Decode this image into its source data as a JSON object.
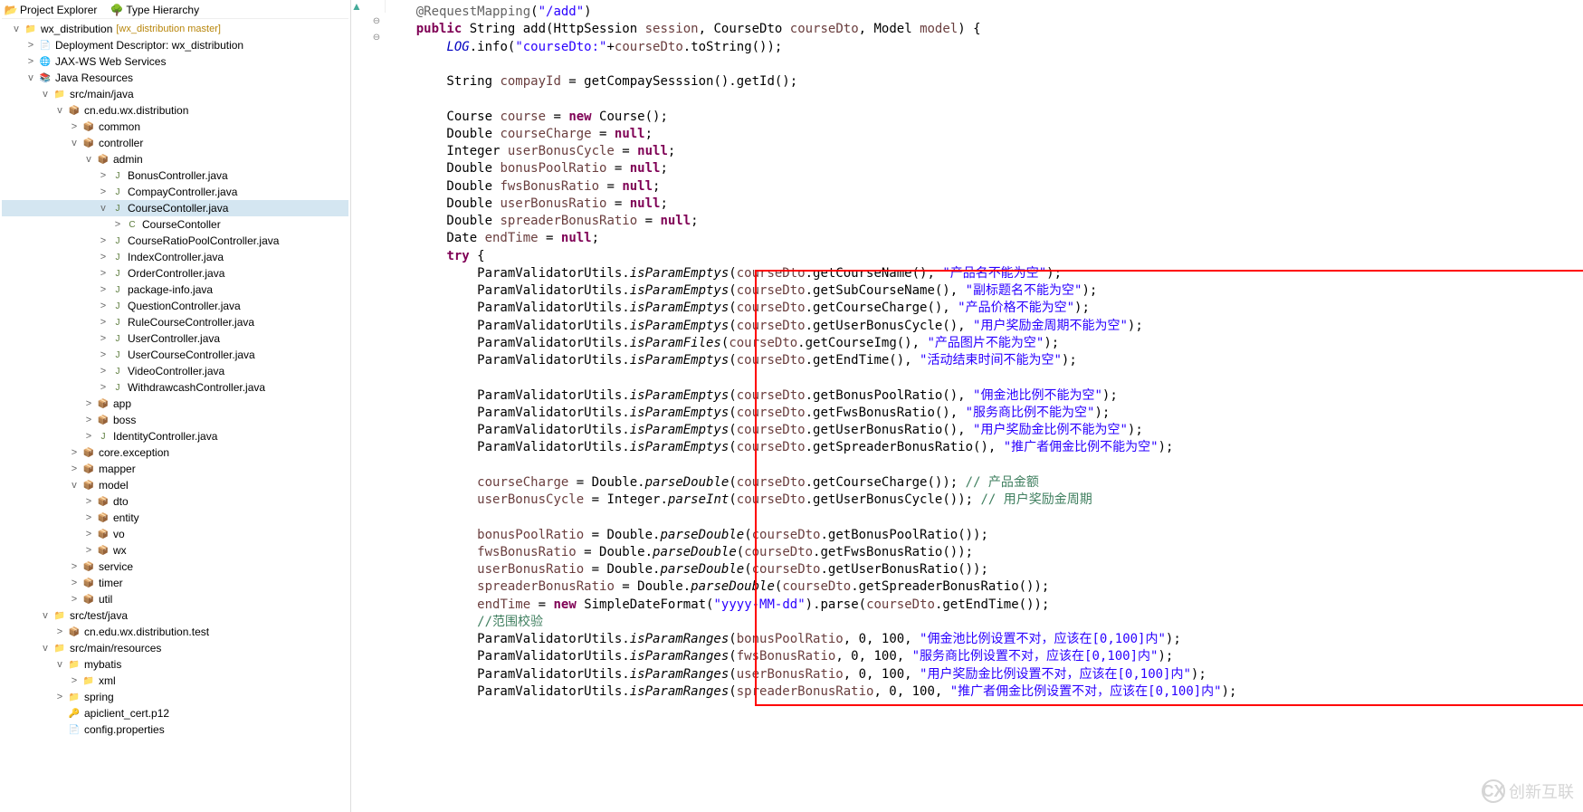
{
  "sidebar": {
    "tab1": "Project Explorer",
    "tab2": "Type Hierarchy",
    "root": {
      "label": "wx_distribution",
      "branch": "[wx_distribution master]"
    },
    "items": [
      {
        "label": "Deployment Descriptor: wx_distribution",
        "ind": 1,
        "exp": ">",
        "icon": "📄",
        "ic": "file-icon"
      },
      {
        "label": "JAX-WS Web Services",
        "ind": 1,
        "exp": ">",
        "icon": "🌐",
        "ic": "file-icon"
      },
      {
        "label": "Java Resources",
        "ind": 1,
        "exp": "v",
        "icon": "📚",
        "ic": "proj-icon"
      },
      {
        "label": "src/main/java",
        "ind": 2,
        "exp": "v",
        "icon": "📁",
        "ic": "folder-icon"
      },
      {
        "label": "cn.edu.wx.distribution",
        "ind": 3,
        "exp": "v",
        "icon": "📦",
        "ic": "pkg-icon"
      },
      {
        "label": "common",
        "ind": 4,
        "exp": ">",
        "icon": "📦",
        "ic": "pkg-icon"
      },
      {
        "label": "controller",
        "ind": 4,
        "exp": "v",
        "icon": "📦",
        "ic": "pkg-icon"
      },
      {
        "label": "admin",
        "ind": 5,
        "exp": "v",
        "icon": "📦",
        "ic": "pkg-icon"
      },
      {
        "label": "BonusController.java",
        "ind": 6,
        "exp": ">",
        "icon": "J",
        "ic": "java-icon"
      },
      {
        "label": "CompayController.java",
        "ind": 6,
        "exp": ">",
        "icon": "J",
        "ic": "java-icon"
      },
      {
        "label": "CourseContoller.java",
        "ind": 6,
        "exp": "v",
        "icon": "J",
        "ic": "java-icon",
        "sel": true
      },
      {
        "label": "CourseContoller",
        "ind": 7,
        "exp": ">",
        "icon": "C",
        "ic": "class-icon"
      },
      {
        "label": "CourseRatioPoolController.java",
        "ind": 6,
        "exp": ">",
        "icon": "J",
        "ic": "java-icon"
      },
      {
        "label": "IndexController.java",
        "ind": 6,
        "exp": ">",
        "icon": "J",
        "ic": "java-icon"
      },
      {
        "label": "OrderController.java",
        "ind": 6,
        "exp": ">",
        "icon": "J",
        "ic": "java-icon"
      },
      {
        "label": "package-info.java",
        "ind": 6,
        "exp": ">",
        "icon": "J",
        "ic": "java-icon"
      },
      {
        "label": "QuestionController.java",
        "ind": 6,
        "exp": ">",
        "icon": "J",
        "ic": "java-icon"
      },
      {
        "label": "RuleCourseController.java",
        "ind": 6,
        "exp": ">",
        "icon": "J",
        "ic": "java-icon"
      },
      {
        "label": "UserController.java",
        "ind": 6,
        "exp": ">",
        "icon": "J",
        "ic": "java-icon"
      },
      {
        "label": "UserCourseController.java",
        "ind": 6,
        "exp": ">",
        "icon": "J",
        "ic": "java-icon"
      },
      {
        "label": "VideoController.java",
        "ind": 6,
        "exp": ">",
        "icon": "J",
        "ic": "java-icon"
      },
      {
        "label": "WithdrawcashController.java",
        "ind": 6,
        "exp": ">",
        "icon": "J",
        "ic": "java-icon"
      },
      {
        "label": "app",
        "ind": 5,
        "exp": ">",
        "icon": "📦",
        "ic": "pkg-icon"
      },
      {
        "label": "boss",
        "ind": 5,
        "exp": ">",
        "icon": "📦",
        "ic": "pkg-icon"
      },
      {
        "label": "IdentityController.java",
        "ind": 5,
        "exp": ">",
        "icon": "J",
        "ic": "java-icon"
      },
      {
        "label": "core.exception",
        "ind": 4,
        "exp": ">",
        "icon": "📦",
        "ic": "pkg-icon"
      },
      {
        "label": "mapper",
        "ind": 4,
        "exp": ">",
        "icon": "📦",
        "ic": "pkg-icon"
      },
      {
        "label": "model",
        "ind": 4,
        "exp": "v",
        "icon": "📦",
        "ic": "pkg-icon"
      },
      {
        "label": "dto",
        "ind": 5,
        "exp": ">",
        "icon": "📦",
        "ic": "pkg-icon"
      },
      {
        "label": "entity",
        "ind": 5,
        "exp": ">",
        "icon": "📦",
        "ic": "pkg-icon"
      },
      {
        "label": "vo",
        "ind": 5,
        "exp": ">",
        "icon": "📦",
        "ic": "pkg-icon"
      },
      {
        "label": "wx",
        "ind": 5,
        "exp": ">",
        "icon": "📦",
        "ic": "pkg-icon"
      },
      {
        "label": "service",
        "ind": 4,
        "exp": ">",
        "icon": "📦",
        "ic": "pkg-icon"
      },
      {
        "label": "timer",
        "ind": 4,
        "exp": ">",
        "icon": "📦",
        "ic": "pkg-icon"
      },
      {
        "label": "util",
        "ind": 4,
        "exp": ">",
        "icon": "📦",
        "ic": "pkg-icon"
      },
      {
        "label": "src/test/java",
        "ind": 2,
        "exp": "v",
        "icon": "📁",
        "ic": "folder-icon"
      },
      {
        "label": "cn.edu.wx.distribution.test",
        "ind": 3,
        "exp": ">",
        "icon": "📦",
        "ic": "pkg-icon"
      },
      {
        "label": "src/main/resources",
        "ind": 2,
        "exp": "v",
        "icon": "📁",
        "ic": "folder-icon"
      },
      {
        "label": "mybatis",
        "ind": 3,
        "exp": "v",
        "icon": "📁",
        "ic": "folder-icon"
      },
      {
        "label": "xml",
        "ind": 4,
        "exp": ">",
        "icon": "📁",
        "ic": "folder-icon"
      },
      {
        "label": "spring",
        "ind": 3,
        "exp": ">",
        "icon": "📁",
        "ic": "folder-icon"
      },
      {
        "label": "apiclient_cert.p12",
        "ind": 3,
        "exp": "",
        "icon": "🔑",
        "ic": "file-icon"
      },
      {
        "label": "config.properties",
        "ind": 3,
        "exp": "",
        "icon": "📄",
        "ic": "file-icon"
      }
    ]
  },
  "code": {
    "l1": {
      "anno": "@RequestMapping",
      "str": "\"/add\""
    },
    "l2": {
      "kw1": "public",
      "t1": "String",
      "m": "add",
      "p1": "HttpSession",
      "v1": "session",
      "p2": "CourseDto",
      "v2": "courseDto",
      "p3": "Model",
      "v3": "model"
    },
    "l3": {
      "fld": "LOG",
      "m": "info",
      "str": "\"courseDto:\"",
      "v": "courseDto",
      "m2": "toString"
    },
    "l4": {
      "t": "String",
      "v": "compayId",
      "m": "getCompaySesssion",
      "m2": "getId"
    },
    "l5": {
      "t": "Course",
      "v": "course",
      "kw": "new",
      "c": "Course"
    },
    "l6": {
      "t": "Double",
      "v": "courseCharge",
      "kw": "null"
    },
    "l7": {
      "t": "Integer",
      "v": "userBonusCycle",
      "kw": "null"
    },
    "l8": {
      "t": "Double",
      "v": "bonusPoolRatio",
      "kw": "null"
    },
    "l9": {
      "t": "Double",
      "v": "fwsBonusRatio",
      "kw": "null"
    },
    "l10": {
      "t": "Double",
      "v": "userBonusRatio",
      "kw": "null"
    },
    "l11": {
      "t": "Double",
      "v": "spreaderBonusRatio",
      "kw": "null"
    },
    "l12": {
      "t": "Date",
      "v": "endTime",
      "kw": "null"
    },
    "l13": {
      "kw": "try"
    },
    "pvLines": [
      {
        "cls": "ParamValidatorUtils",
        "m": "isParamEmptys",
        "v": "courseDto",
        "g": "getCourseName",
        "str": "\"产品名不能为空\""
      },
      {
        "cls": "ParamValidatorUtils",
        "m": "isParamEmptys",
        "v": "courseDto",
        "g": "getSubCourseName",
        "str": "\"副标题名不能为空\""
      },
      {
        "cls": "ParamValidatorUtils",
        "m": "isParamEmptys",
        "v": "courseDto",
        "g": "getCourseCharge",
        "str": "\"产品价格不能为空\""
      },
      {
        "cls": "ParamValidatorUtils",
        "m": "isParamEmptys",
        "v": "courseDto",
        "g": "getUserBonusCycle",
        "str": "\"用户奖励金周期不能为空\""
      },
      {
        "cls": "ParamValidatorUtils",
        "m": "isParamFiles",
        "v": "courseDto",
        "g": "getCourseImg",
        "str": "\"产品图片不能为空\""
      },
      {
        "cls": "ParamValidatorUtils",
        "m": "isParamEmptys",
        "v": "courseDto",
        "g": "getEndTime",
        "str": "\"活动结束时间不能为空\""
      }
    ],
    "pvLines2": [
      {
        "cls": "ParamValidatorUtils",
        "m": "isParamEmptys",
        "v": "courseDto",
        "g": "getBonusPoolRatio",
        "str": "\"佣金池比例不能为空\""
      },
      {
        "cls": "ParamValidatorUtils",
        "m": "isParamEmptys",
        "v": "courseDto",
        "g": "getFwsBonusRatio",
        "str": "\"服务商比例不能为空\""
      },
      {
        "cls": "ParamValidatorUtils",
        "m": "isParamEmptys",
        "v": "courseDto",
        "g": "getUserBonusRatio",
        "str": "\"用户奖励金比例不能为空\""
      },
      {
        "cls": "ParamValidatorUtils",
        "m": "isParamEmptys",
        "v": "courseDto",
        "g": "getSpreaderBonusRatio",
        "str": "\"推广者佣金比例不能为空\""
      }
    ],
    "assign1": {
      "v": "courseCharge",
      "cls": "Double",
      "m": "parseDouble",
      "a": "courseDto",
      "g": "getCourseCharge",
      "cmt": "// 产品金额"
    },
    "assign2": {
      "v": "userBonusCycle",
      "cls": "Integer",
      "m": "parseInt",
      "a": "courseDto",
      "g": "getUserBonusCycle",
      "cmt": "// 用户奖励金周期"
    },
    "assign3": {
      "v": "bonusPoolRatio",
      "cls": "Double",
      "m": "parseDouble",
      "a": "courseDto",
      "g": "getBonusPoolRatio"
    },
    "assign4": {
      "v": "fwsBonusRatio",
      "cls": "Double",
      "m": "parseDouble",
      "a": "courseDto",
      "g": "getFwsBonusRatio"
    },
    "assign5": {
      "v": "userBonusRatio",
      "cls": "Double",
      "m": "parseDouble",
      "a": "courseDto",
      "g": "getUserBonusRatio"
    },
    "assign6": {
      "v": "spreaderBonusRatio",
      "cls": "Double",
      "m": "parseDouble",
      "a": "courseDto",
      "g": "getSpreaderBonusRatio"
    },
    "assign7": {
      "v": "endTime",
      "kw": "new",
      "cls": "SimpleDateFormat",
      "str": "\"yyyy-MM-dd\"",
      "m": "parse",
      "a": "courseDto",
      "g": "getEndTime"
    },
    "cmt_range": "//范围校验",
    "ranges": [
      {
        "cls": "ParamValidatorUtils",
        "m": "isParamRanges",
        "v": "bonusPoolRatio",
        "n1": "0",
        "n2": "100",
        "str": "\"佣金池比例设置不对，应该在[0,100]内\""
      },
      {
        "cls": "ParamValidatorUtils",
        "m": "isParamRanges",
        "v": "fwsBonusRatio",
        "n1": "0",
        "n2": "100",
        "str": "\"服务商比例设置不对，应该在[0,100]内\""
      },
      {
        "cls": "ParamValidatorUtils",
        "m": "isParamRanges",
        "v": "userBonusRatio",
        "n1": "0",
        "n2": "100",
        "str": "\"用户奖励金比例设置不对，应该在[0,100]内\""
      },
      {
        "cls": "ParamValidatorUtils",
        "m": "isParamRanges",
        "v": "spreaderBonusRatio",
        "n1": "0",
        "n2": "100",
        "str": "\"推广者佣金比例设置不对，应该在[0,100]内\""
      }
    ]
  },
  "watermark": {
    "badge": "CX",
    "text": "创新互联"
  }
}
